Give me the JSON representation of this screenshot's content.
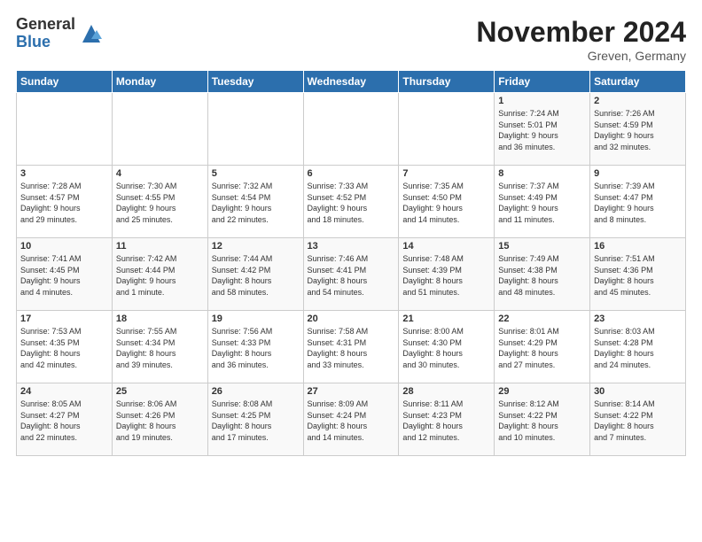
{
  "logo": {
    "general": "General",
    "blue": "Blue"
  },
  "header": {
    "month": "November 2024",
    "location": "Greven, Germany"
  },
  "weekdays": [
    "Sunday",
    "Monday",
    "Tuesday",
    "Wednesday",
    "Thursday",
    "Friday",
    "Saturday"
  ],
  "weeks": [
    [
      {
        "day": "",
        "info": ""
      },
      {
        "day": "",
        "info": ""
      },
      {
        "day": "",
        "info": ""
      },
      {
        "day": "",
        "info": ""
      },
      {
        "day": "",
        "info": ""
      },
      {
        "day": "1",
        "info": "Sunrise: 7:24 AM\nSunset: 5:01 PM\nDaylight: 9 hours\nand 36 minutes."
      },
      {
        "day": "2",
        "info": "Sunrise: 7:26 AM\nSunset: 4:59 PM\nDaylight: 9 hours\nand 32 minutes."
      }
    ],
    [
      {
        "day": "3",
        "info": "Sunrise: 7:28 AM\nSunset: 4:57 PM\nDaylight: 9 hours\nand 29 minutes."
      },
      {
        "day": "4",
        "info": "Sunrise: 7:30 AM\nSunset: 4:55 PM\nDaylight: 9 hours\nand 25 minutes."
      },
      {
        "day": "5",
        "info": "Sunrise: 7:32 AM\nSunset: 4:54 PM\nDaylight: 9 hours\nand 22 minutes."
      },
      {
        "day": "6",
        "info": "Sunrise: 7:33 AM\nSunset: 4:52 PM\nDaylight: 9 hours\nand 18 minutes."
      },
      {
        "day": "7",
        "info": "Sunrise: 7:35 AM\nSunset: 4:50 PM\nDaylight: 9 hours\nand 14 minutes."
      },
      {
        "day": "8",
        "info": "Sunrise: 7:37 AM\nSunset: 4:49 PM\nDaylight: 9 hours\nand 11 minutes."
      },
      {
        "day": "9",
        "info": "Sunrise: 7:39 AM\nSunset: 4:47 PM\nDaylight: 9 hours\nand 8 minutes."
      }
    ],
    [
      {
        "day": "10",
        "info": "Sunrise: 7:41 AM\nSunset: 4:45 PM\nDaylight: 9 hours\nand 4 minutes."
      },
      {
        "day": "11",
        "info": "Sunrise: 7:42 AM\nSunset: 4:44 PM\nDaylight: 9 hours\nand 1 minute."
      },
      {
        "day": "12",
        "info": "Sunrise: 7:44 AM\nSunset: 4:42 PM\nDaylight: 8 hours\nand 58 minutes."
      },
      {
        "day": "13",
        "info": "Sunrise: 7:46 AM\nSunset: 4:41 PM\nDaylight: 8 hours\nand 54 minutes."
      },
      {
        "day": "14",
        "info": "Sunrise: 7:48 AM\nSunset: 4:39 PM\nDaylight: 8 hours\nand 51 minutes."
      },
      {
        "day": "15",
        "info": "Sunrise: 7:49 AM\nSunset: 4:38 PM\nDaylight: 8 hours\nand 48 minutes."
      },
      {
        "day": "16",
        "info": "Sunrise: 7:51 AM\nSunset: 4:36 PM\nDaylight: 8 hours\nand 45 minutes."
      }
    ],
    [
      {
        "day": "17",
        "info": "Sunrise: 7:53 AM\nSunset: 4:35 PM\nDaylight: 8 hours\nand 42 minutes."
      },
      {
        "day": "18",
        "info": "Sunrise: 7:55 AM\nSunset: 4:34 PM\nDaylight: 8 hours\nand 39 minutes."
      },
      {
        "day": "19",
        "info": "Sunrise: 7:56 AM\nSunset: 4:33 PM\nDaylight: 8 hours\nand 36 minutes."
      },
      {
        "day": "20",
        "info": "Sunrise: 7:58 AM\nSunset: 4:31 PM\nDaylight: 8 hours\nand 33 minutes."
      },
      {
        "day": "21",
        "info": "Sunrise: 8:00 AM\nSunset: 4:30 PM\nDaylight: 8 hours\nand 30 minutes."
      },
      {
        "day": "22",
        "info": "Sunrise: 8:01 AM\nSunset: 4:29 PM\nDaylight: 8 hours\nand 27 minutes."
      },
      {
        "day": "23",
        "info": "Sunrise: 8:03 AM\nSunset: 4:28 PM\nDaylight: 8 hours\nand 24 minutes."
      }
    ],
    [
      {
        "day": "24",
        "info": "Sunrise: 8:05 AM\nSunset: 4:27 PM\nDaylight: 8 hours\nand 22 minutes."
      },
      {
        "day": "25",
        "info": "Sunrise: 8:06 AM\nSunset: 4:26 PM\nDaylight: 8 hours\nand 19 minutes."
      },
      {
        "day": "26",
        "info": "Sunrise: 8:08 AM\nSunset: 4:25 PM\nDaylight: 8 hours\nand 17 minutes."
      },
      {
        "day": "27",
        "info": "Sunrise: 8:09 AM\nSunset: 4:24 PM\nDaylight: 8 hours\nand 14 minutes."
      },
      {
        "day": "28",
        "info": "Sunrise: 8:11 AM\nSunset: 4:23 PM\nDaylight: 8 hours\nand 12 minutes."
      },
      {
        "day": "29",
        "info": "Sunrise: 8:12 AM\nSunset: 4:22 PM\nDaylight: 8 hours\nand 10 minutes."
      },
      {
        "day": "30",
        "info": "Sunrise: 8:14 AM\nSunset: 4:22 PM\nDaylight: 8 hours\nand 7 minutes."
      }
    ]
  ]
}
